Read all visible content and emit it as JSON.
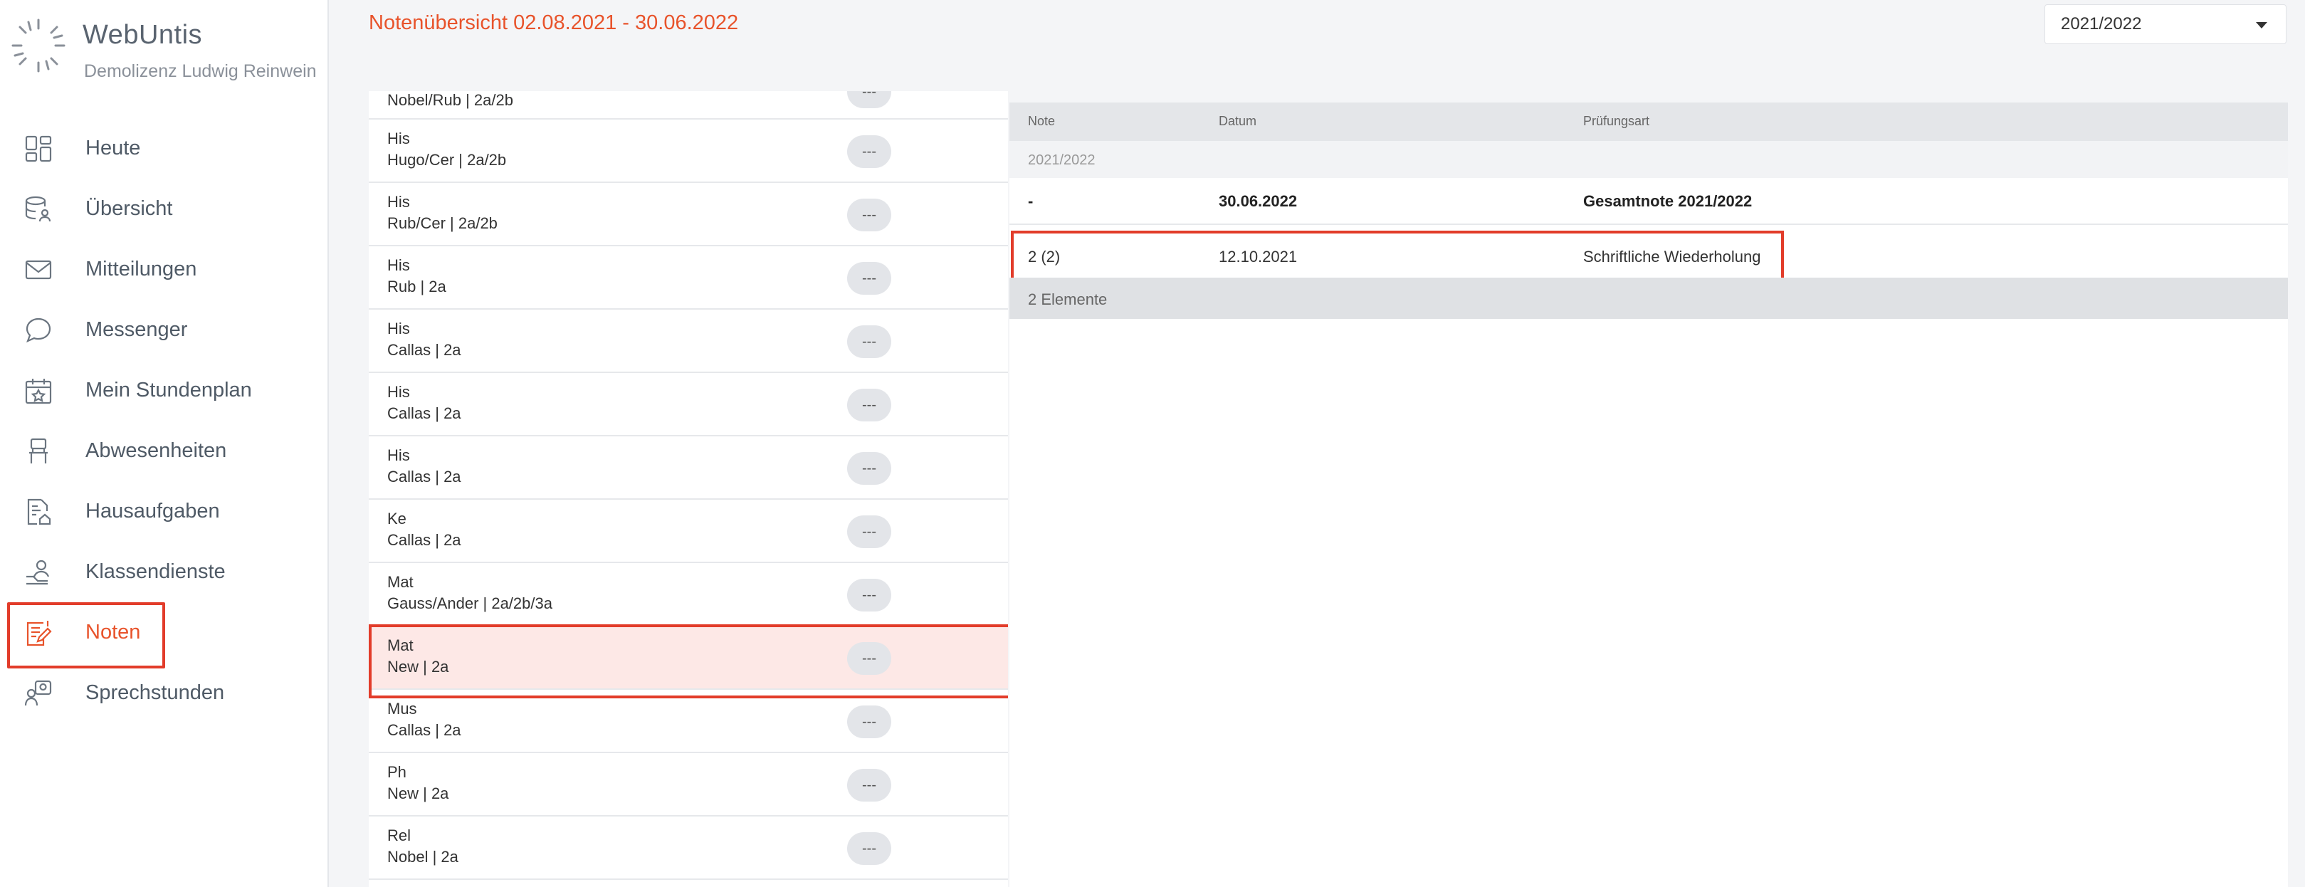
{
  "brand": {
    "title": "WebUntis",
    "subtitle": "Demolizenz Ludwig Reinwein"
  },
  "colors": {
    "accent": "#e8532b",
    "highlight_border": "#e23c2a",
    "selected_bg": "#fde8e6"
  },
  "nav": {
    "items": [
      {
        "label": "Heute",
        "icon": "dashboard-icon"
      },
      {
        "label": "Übersicht",
        "icon": "database-user-icon"
      },
      {
        "label": "Mitteilungen",
        "icon": "mail-icon"
      },
      {
        "label": "Messenger",
        "icon": "chat-bubble-icon"
      },
      {
        "label": "Mein Stundenplan",
        "icon": "calendar-star-icon"
      },
      {
        "label": "Abwesenheiten",
        "icon": "chair-icon"
      },
      {
        "label": "Hausaufgaben",
        "icon": "document-house-icon"
      },
      {
        "label": "Klassendienste",
        "icon": "person-service-icon"
      },
      {
        "label": "Noten",
        "icon": "grade-document-icon"
      },
      {
        "label": "Sprechstunden",
        "icon": "consultation-icon"
      }
    ]
  },
  "header": {
    "title": "Notenübersicht 02.08.2021 - 30.06.2022",
    "year_select": "2021/2022"
  },
  "subjects": [
    {
      "name": "",
      "teacher": "Nobel/Rub | 2a/2b",
      "grade": "---"
    },
    {
      "name": "His",
      "teacher": "Hugo/Cer | 2a/2b",
      "grade": "---"
    },
    {
      "name": "His",
      "teacher": "Rub/Cer | 2a/2b",
      "grade": "---"
    },
    {
      "name": "His",
      "teacher": "Rub | 2a",
      "grade": "---"
    },
    {
      "name": "His",
      "teacher": "Callas | 2a",
      "grade": "---"
    },
    {
      "name": "His",
      "teacher": "Callas | 2a",
      "grade": "---"
    },
    {
      "name": "His",
      "teacher": "Callas | 2a",
      "grade": "---"
    },
    {
      "name": "Ke",
      "teacher": "Callas | 2a",
      "grade": "---"
    },
    {
      "name": "Mat",
      "teacher": "Gauss/Ander | 2a/2b/3a",
      "grade": "---"
    },
    {
      "name": "Mat",
      "teacher": "New | 2a",
      "grade": "---"
    },
    {
      "name": "Mus",
      "teacher": "Callas | 2a",
      "grade": "---"
    },
    {
      "name": "Ph",
      "teacher": "New | 2a",
      "grade": "---"
    },
    {
      "name": "Rel",
      "teacher": "Nobel | 2a",
      "grade": "---"
    }
  ],
  "detail": {
    "columns": {
      "note": "Note",
      "datum": "Datum",
      "pruefungsart": "Prüfungsart"
    },
    "year_label": "2021/2022",
    "total": {
      "note": "-",
      "datum": "30.06.2022",
      "pruefungsart": "Gesamtnote 2021/2022"
    },
    "row": {
      "note": "2 (2)",
      "datum": "12.10.2021",
      "pruefungsart": "Schriftliche Wiederholung"
    },
    "footer": "2 Elemente"
  }
}
